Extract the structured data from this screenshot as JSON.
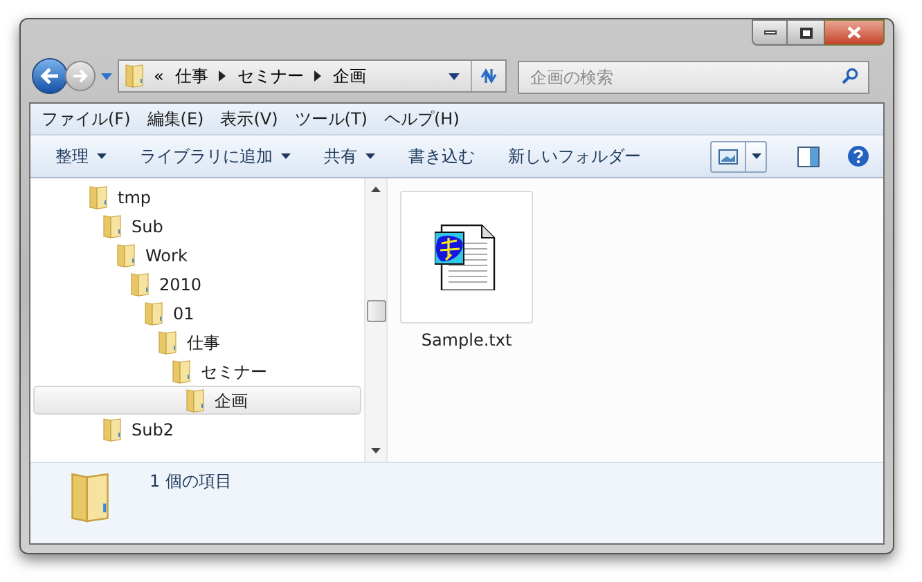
{
  "address_bar": {
    "overflow": "«",
    "crumbs": [
      "仕事",
      "セミナー",
      "企画"
    ]
  },
  "search": {
    "placeholder": "企画の検索"
  },
  "menu_bar": [
    "ファイル(F)",
    "編集(E)",
    "表示(V)",
    "ツール(T)",
    "ヘルプ(H)"
  ],
  "toolbar": [
    {
      "label": "整理",
      "has_menu": true
    },
    {
      "label": "ライブラリに追加",
      "has_menu": true
    },
    {
      "label": "共有",
      "has_menu": true
    },
    {
      "label": "書き込む",
      "has_menu": false
    },
    {
      "label": "新しいフォルダー",
      "has_menu": false
    }
  ],
  "tree": [
    {
      "label": "tmp",
      "selected": false,
      "children": [
        {
          "label": "Sub",
          "selected": false,
          "children": [
            {
              "label": "Work",
              "selected": false,
              "children": [
                {
                  "label": "2010",
                  "selected": false,
                  "children": [
                    {
                      "label": "01",
                      "selected": false,
                      "children": [
                        {
                          "label": "仕事",
                          "selected": false,
                          "children": [
                            {
                              "label": "セミナー",
                              "selected": false,
                              "children": [
                                {
                                  "label": "企画",
                                  "selected": true
                                }
                              ]
                            }
                          ]
                        }
                      ]
                    }
                  ]
                }
              ]
            }
          ]
        },
        {
          "label": "Sub2",
          "selected": false
        }
      ]
    }
  ],
  "files": [
    {
      "name": "Sample.txt"
    }
  ],
  "status_bar": {
    "text": "1 個の項目"
  }
}
